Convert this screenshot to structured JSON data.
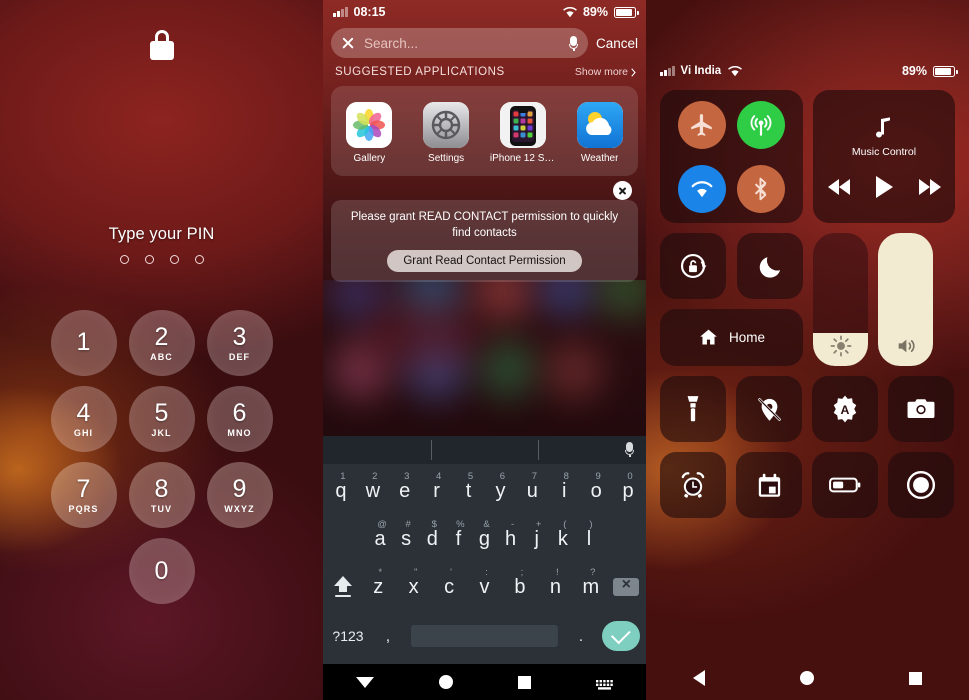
{
  "lockscreen": {
    "lock_icon": "lock-icon",
    "prompt": "Type your PIN",
    "pin_dots": 4,
    "keys": [
      {
        "num": "1",
        "letters": ""
      },
      {
        "num": "2",
        "letters": "ABC"
      },
      {
        "num": "3",
        "letters": "DEF"
      },
      {
        "num": "4",
        "letters": "GHI"
      },
      {
        "num": "5",
        "letters": "JKL"
      },
      {
        "num": "6",
        "letters": "MNO"
      },
      {
        "num": "7",
        "letters": "PQRS"
      },
      {
        "num": "8",
        "letters": "TUV"
      },
      {
        "num": "9",
        "letters": "WXYZ"
      },
      {
        "num": "0",
        "letters": ""
      }
    ]
  },
  "search_panel": {
    "status": {
      "time": "08:15",
      "battery_percent": "89%",
      "battery_level": 89,
      "wifi_icon": "wifi-icon",
      "signal_icon": "signal-bars-icon"
    },
    "search": {
      "placeholder": "Search...",
      "value": "",
      "clear_icon": "close-x-icon",
      "mic_icon": "microphone-icon",
      "cancel_label": "Cancel"
    },
    "suggested": {
      "section_title": "SUGGESTED APPLICATIONS",
      "show_more_label": "Show more",
      "chevron_icon": "chevron-right-icon",
      "apps": [
        {
          "name": "Gallery",
          "icon": "gallery-icon"
        },
        {
          "name": "Settings",
          "icon": "settings-gear-icon"
        },
        {
          "name": "iPhone 12 Setti...",
          "icon": "iphone-12-settings-icon"
        },
        {
          "name": "Weather",
          "icon": "weather-icon"
        }
      ]
    },
    "permission": {
      "message": "Please grant READ CONTACT permission to quickly find contacts",
      "button_label": "Grant Read Contact Permission",
      "close_icon": "close-circle-icon"
    },
    "floating_button": {
      "icon": "camera-shutter-icon"
    },
    "keyboard": {
      "mic_icon": "microphone-icon",
      "row1": [
        {
          "main": "q",
          "sup": "1"
        },
        {
          "main": "w",
          "sup": "2"
        },
        {
          "main": "e",
          "sup": "3"
        },
        {
          "main": "r",
          "sup": "4"
        },
        {
          "main": "t",
          "sup": "5"
        },
        {
          "main": "y",
          "sup": "6"
        },
        {
          "main": "u",
          "sup": "7"
        },
        {
          "main": "i",
          "sup": "8"
        },
        {
          "main": "o",
          "sup": "9"
        },
        {
          "main": "p",
          "sup": "0"
        }
      ],
      "row2": [
        {
          "main": "a",
          "sup": "@"
        },
        {
          "main": "s",
          "sup": "#"
        },
        {
          "main": "d",
          "sup": "$"
        },
        {
          "main": "f",
          "sup": "%"
        },
        {
          "main": "g",
          "sup": "&"
        },
        {
          "main": "h",
          "sup": "-"
        },
        {
          "main": "j",
          "sup": "+"
        },
        {
          "main": "k",
          "sup": "("
        },
        {
          "main": "l",
          "sup": ")"
        }
      ],
      "row3": [
        {
          "main": "z",
          "sup": "*"
        },
        {
          "main": "x",
          "sup": "\""
        },
        {
          "main": "c",
          "sup": "'"
        },
        {
          "main": "v",
          "sup": ":"
        },
        {
          "main": "b",
          "sup": ";"
        },
        {
          "main": "n",
          "sup": "!"
        },
        {
          "main": "m",
          "sup": "?"
        }
      ],
      "shift_icon": "shift-key-icon",
      "delete_icon": "backspace-icon",
      "numeric_label": "?123",
      "comma_label": ",",
      "period_label": ".",
      "space_label": "",
      "enter_icon": "check-enter-icon"
    },
    "navbar": {
      "back_icon": "nav-back-icon",
      "home_icon": "nav-home-icon",
      "recents_icon": "nav-recents-icon",
      "keyboard_icon": "nav-keyboard-icon"
    }
  },
  "control_center": {
    "status": {
      "carrier": "Vi India",
      "battery_percent": "89%",
      "battery_level": 89,
      "wifi_icon": "wifi-icon",
      "signal_icon": "signal-bars-icon"
    },
    "connectivity": [
      {
        "name": "airplane-mode-toggle",
        "icon": "airplane-icon",
        "active": false,
        "color": "#c4663f"
      },
      {
        "name": "cellular-data-toggle",
        "icon": "cellular-signal-icon",
        "active": true,
        "color": "#2fcc45"
      },
      {
        "name": "wifi-toggle",
        "icon": "wifi-icon",
        "active": true,
        "color": "#1a84e8"
      },
      {
        "name": "bluetooth-toggle",
        "icon": "bluetooth-icon",
        "active": false,
        "color": "#c4663f"
      }
    ],
    "music": {
      "label": "Music Control",
      "note_icon": "music-note-icon",
      "prev_icon": "rewind-icon",
      "play_icon": "play-icon",
      "next_icon": "fast-forward-icon"
    },
    "rotation_lock": {
      "icon": "rotation-lock-icon"
    },
    "do_not_disturb": {
      "icon": "moon-icon"
    },
    "home": {
      "label": "Home",
      "icon": "home-icon"
    },
    "brightness": {
      "icon": "brightness-sun-icon",
      "value": 25
    },
    "volume": {
      "icon": "volume-icon",
      "value": 100
    },
    "shortcuts": [
      {
        "name": "flashlight-toggle",
        "icon": "flashlight-icon"
      },
      {
        "name": "location-toggle",
        "icon": "location-off-icon"
      },
      {
        "name": "auto-brightness-toggle",
        "icon": "auto-brightness-icon"
      },
      {
        "name": "camera-shortcut",
        "icon": "camera-icon"
      },
      {
        "name": "alarm-shortcut",
        "icon": "alarm-clock-icon"
      },
      {
        "name": "calendar-shortcut",
        "icon": "calendar-icon"
      },
      {
        "name": "battery-saver-toggle",
        "icon": "battery-saver-icon"
      },
      {
        "name": "screen-record-button",
        "icon": "screen-record-icon"
      }
    ],
    "navbar": {
      "back_icon": "nav-back-icon",
      "home_icon": "nav-home-icon",
      "recents_icon": "nav-recents-icon"
    }
  }
}
